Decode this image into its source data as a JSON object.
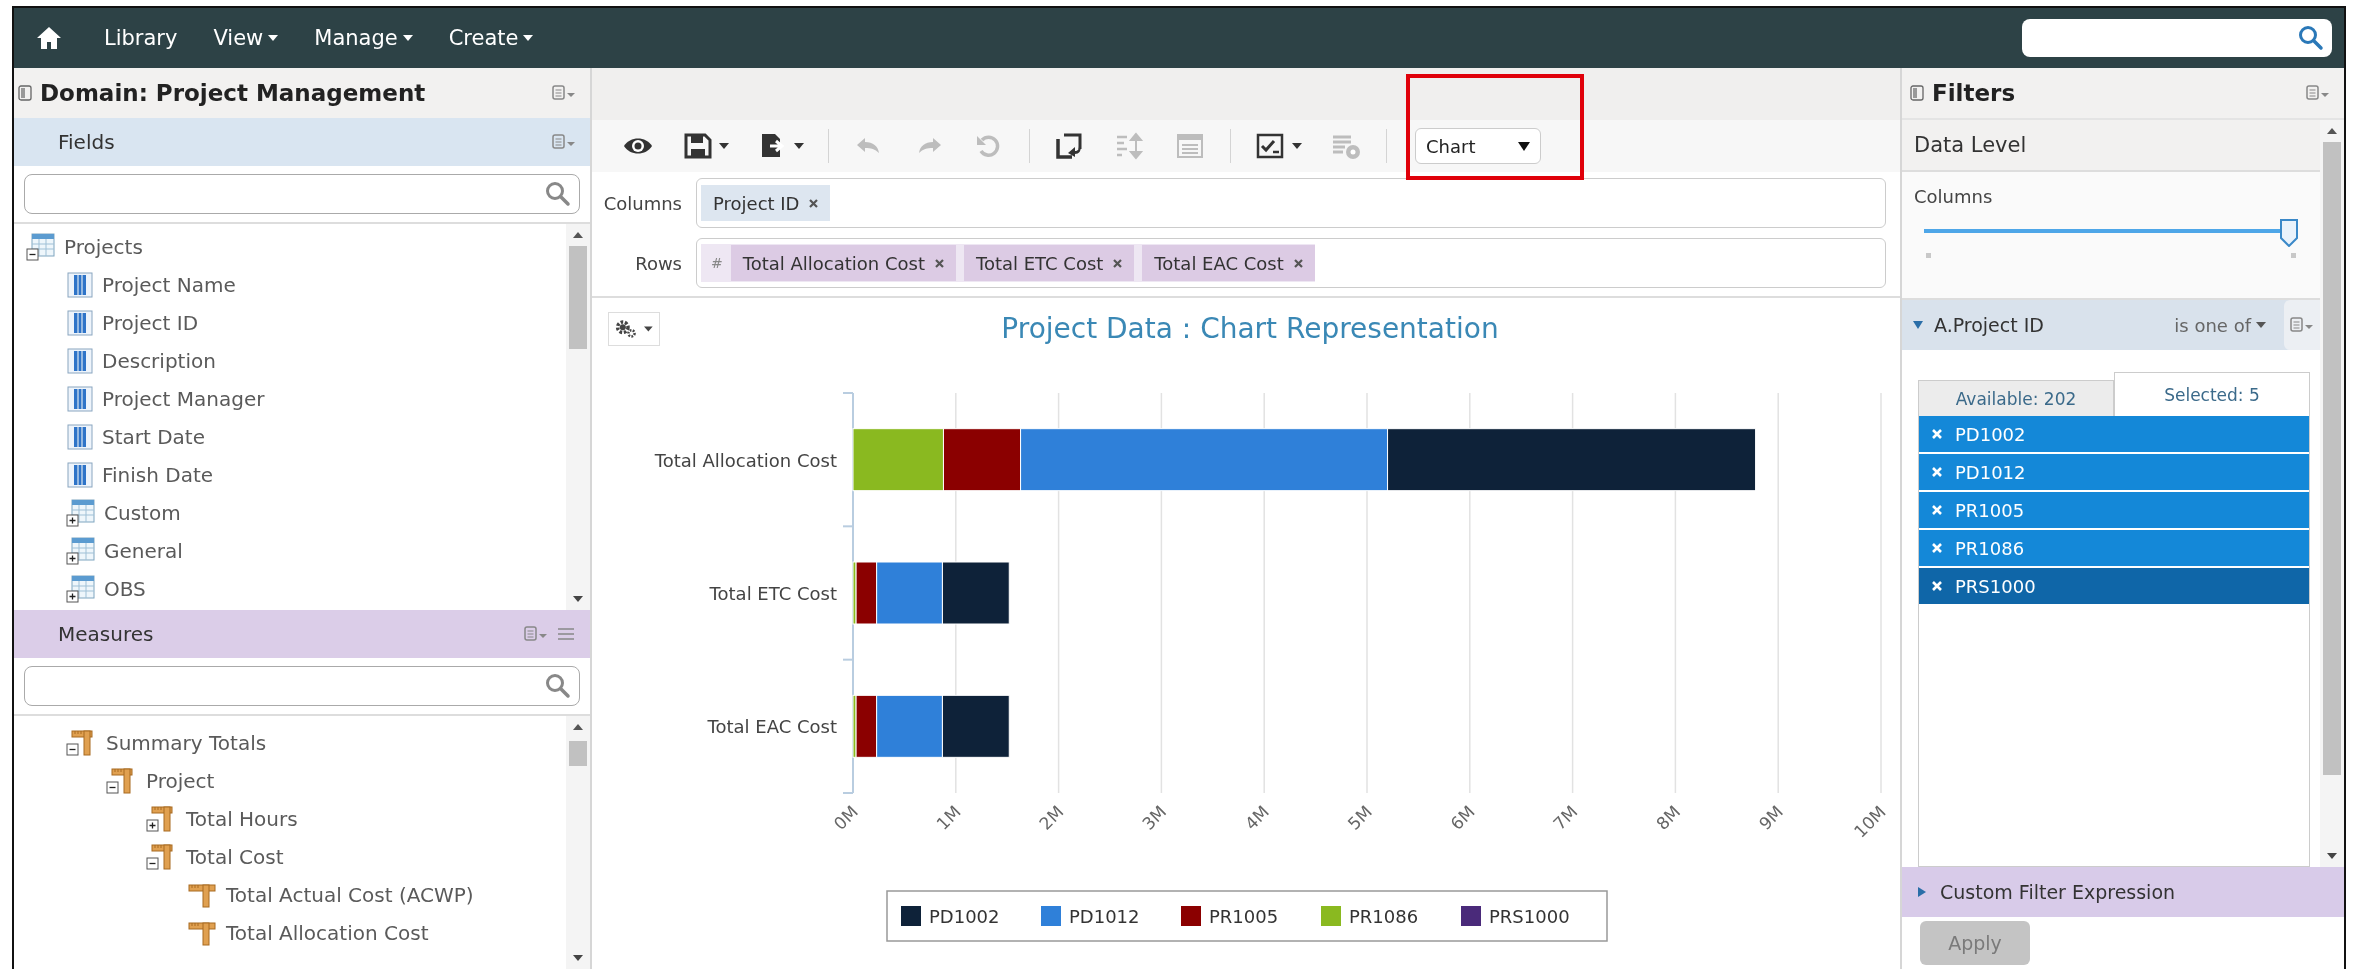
{
  "nav": {
    "items": [
      {
        "label": "Library",
        "caret": false
      },
      {
        "label": "View",
        "caret": true
      },
      {
        "label": "Manage",
        "caret": true
      },
      {
        "label": "Create",
        "caret": true
      }
    ]
  },
  "domain_panel": {
    "title": "Domain: Project Management",
    "fields": {
      "title": "Fields",
      "tree": [
        {
          "label": "Projects",
          "kind": "table",
          "expanded": true,
          "children": [
            {
              "label": "Project Name",
              "kind": "field"
            },
            {
              "label": "Project ID",
              "kind": "field"
            },
            {
              "label": "Description",
              "kind": "field"
            },
            {
              "label": "Project Manager",
              "kind": "field"
            },
            {
              "label": "Start Date",
              "kind": "field"
            },
            {
              "label": "Finish Date",
              "kind": "field"
            },
            {
              "label": "Custom",
              "kind": "table",
              "expanded": false
            },
            {
              "label": "General",
              "kind": "table",
              "expanded": false
            },
            {
              "label": "OBS",
              "kind": "table",
              "expanded": false
            }
          ]
        }
      ]
    },
    "measures": {
      "title": "Measures",
      "tree": [
        {
          "label": "Summary Totals",
          "kind": "group",
          "expanded": true,
          "children": [
            {
              "label": "Project",
              "kind": "group",
              "expanded": true,
              "children": [
                {
                  "label": "Total Hours",
                  "kind": "group",
                  "expanded": false
                },
                {
                  "label": "Total Cost",
                  "kind": "group",
                  "expanded": true,
                  "children": [
                    {
                      "label": "Total Actual Cost (ACWP)",
                      "kind": "measure"
                    },
                    {
                      "label": "Total Allocation Cost",
                      "kind": "measure"
                    }
                  ]
                }
              ]
            }
          ]
        }
      ]
    }
  },
  "editor": {
    "toolbar": [
      {
        "kind": "view",
        "disabled": false,
        "caret": false
      },
      {
        "kind": "save",
        "disabled": false,
        "caret": true
      },
      {
        "kind": "export",
        "disabled": false,
        "caret": true
      },
      {
        "kind": "undo",
        "disabled": true,
        "caret": false
      },
      {
        "kind": "redo",
        "disabled": true,
        "caret": false
      },
      {
        "kind": "reset",
        "disabled": true,
        "caret": false
      },
      {
        "kind": "switch",
        "disabled": false,
        "caret": false
      },
      {
        "kind": "sort",
        "disabled": true,
        "caret": false
      },
      {
        "kind": "details",
        "disabled": true,
        "caret": false
      },
      {
        "kind": "options",
        "disabled": false,
        "caret": true
      },
      {
        "kind": "sql",
        "disabled": true,
        "caret": false
      }
    ],
    "view_select": {
      "value": "Chart"
    },
    "columns": {
      "label": "Columns",
      "pills": [
        {
          "label": "Project ID"
        }
      ]
    },
    "rows": {
      "label": "Rows",
      "prefix": "#",
      "pills": [
        {
          "label": "Total Allocation Cost"
        },
        {
          "label": "Total ETC Cost"
        },
        {
          "label": "Total EAC Cost"
        }
      ]
    },
    "chart": {
      "chart_data": {
        "type": "bar",
        "orientation": "horizontal",
        "stacked": true,
        "title": "Project Data : Chart Representation",
        "categories": [
          "Total Allocation Cost",
          "Total ETC Cost",
          "Total EAC Cost"
        ],
        "series": [
          {
            "name": "PRS1000",
            "color": "#4a2a7a",
            "values": [
              0,
              0,
              0
            ]
          },
          {
            "name": "PR1086",
            "color": "#8ab920",
            "values": [
              0.88,
              0.03,
              0.03
            ]
          },
          {
            "name": "PR1005",
            "color": "#8b0000",
            "values": [
              0.75,
              0.2,
              0.2
            ]
          },
          {
            "name": "PD1012",
            "color": "#2f80d9",
            "values": [
              3.57,
              0.64,
              0.64
            ]
          },
          {
            "name": "PD1002",
            "color": "#0e2239",
            "values": [
              3.58,
              0.65,
              0.65
            ]
          }
        ],
        "grid": true,
        "legend": true,
        "xlim": [
          0,
          10
        ],
        "xticks": [
          {
            "value": 0,
            "label": "0M"
          },
          {
            "value": 1,
            "label": "1M"
          },
          {
            "value": 2,
            "label": "2M"
          },
          {
            "value": 3,
            "label": "3M"
          },
          {
            "value": 4,
            "label": "4M"
          },
          {
            "value": 5,
            "label": "5M"
          },
          {
            "value": 6,
            "label": "6M"
          },
          {
            "value": 7,
            "label": "7M"
          },
          {
            "value": 8,
            "label": "8M"
          },
          {
            "value": 9,
            "label": "9M"
          },
          {
            "value": 10,
            "label": "10M"
          }
        ]
      }
    }
  },
  "filters": {
    "title": "Filters",
    "data_level": {
      "title": "Data Level",
      "label": "Columns",
      "level": 1
    },
    "filter": {
      "field": "A.Project ID",
      "operator": "is one of",
      "expanded": true,
      "tabs": [
        {
          "label": "Available: 202",
          "selected": false
        },
        {
          "label": "Selected: 5",
          "selected": true
        }
      ],
      "values": [
        {
          "label": "PD1002",
          "selected": false
        },
        {
          "label": "PD1012",
          "selected": false
        },
        {
          "label": "PR1005",
          "selected": false
        },
        {
          "label": "PR1086",
          "selected": false
        },
        {
          "label": "PRS1000",
          "selected": true
        }
      ]
    },
    "custom_expression": {
      "label": "Custom Filter Expression",
      "expanded": false
    },
    "apply": {
      "label": "Apply",
      "disabled": true
    }
  }
}
